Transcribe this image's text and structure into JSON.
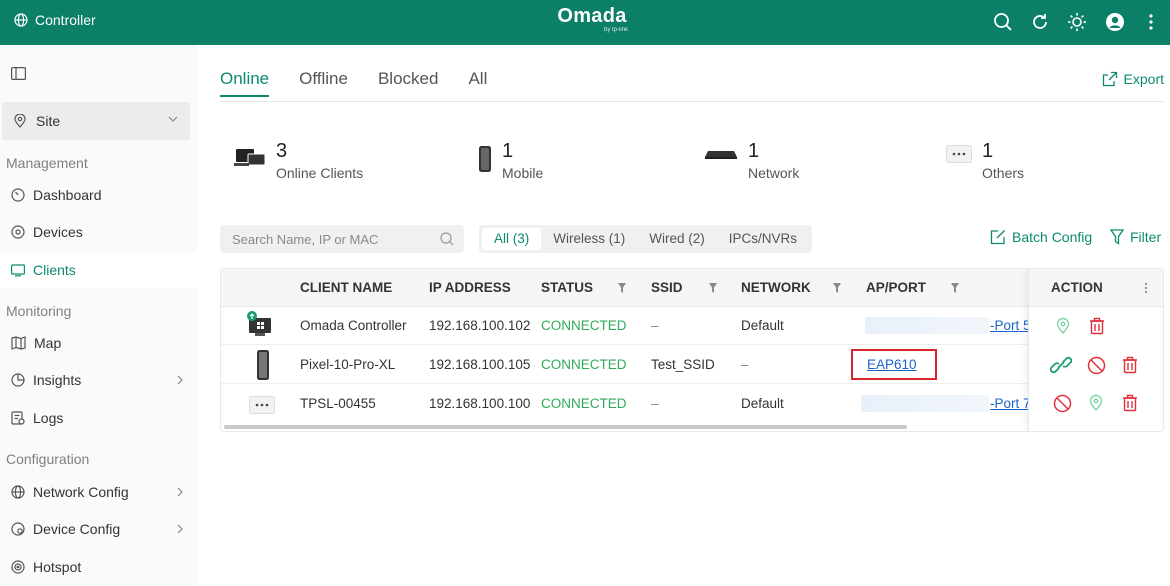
{
  "topbar": {
    "brand": "Controller",
    "logo": "Omada",
    "logo_sub": "by tp-link"
  },
  "sidebar": {
    "site_label": "Site",
    "groups": [
      "Management",
      "Monitoring",
      "Configuration"
    ],
    "items": [
      {
        "label": "Dashboard"
      },
      {
        "label": "Devices"
      },
      {
        "label": "Clients"
      },
      {
        "label": "Map"
      },
      {
        "label": "Insights"
      },
      {
        "label": "Logs"
      },
      {
        "label": "Network Config"
      },
      {
        "label": "Device Config"
      },
      {
        "label": "Hotspot"
      }
    ]
  },
  "tabs": [
    "Online",
    "Offline",
    "Blocked",
    "All"
  ],
  "export_label": "Export",
  "summary": [
    {
      "count": "3",
      "label": "Online Clients"
    },
    {
      "count": "1",
      "label": "Mobile"
    },
    {
      "count": "1",
      "label": "Network"
    },
    {
      "count": "1",
      "label": "Others"
    }
  ],
  "search": {
    "placeholder": "Search Name, IP or MAC"
  },
  "filters": [
    "All (3)",
    "Wireless (1)",
    "Wired (2)",
    "IPCs/NVRs"
  ],
  "batch_config_label": "Batch Config",
  "filter_label": "Filter",
  "table": {
    "headers": [
      "CLIENT NAME",
      "IP ADDRESS",
      "STATUS",
      "SSID",
      "NETWORK",
      "AP/PORT",
      "ACTION"
    ],
    "rows": [
      {
        "name": "Omada Controller",
        "ip": "192.168.100.102",
        "status": "CONNECTED",
        "ssid": "–",
        "network": "Default",
        "ap": "-Port 5"
      },
      {
        "name": "Pixel-10-Pro-XL",
        "ip": "192.168.100.105",
        "status": "CONNECTED",
        "ssid": "Test_SSID",
        "network": "–",
        "ap": "EAP610"
      },
      {
        "name": "TPSL-00455",
        "ip": "192.168.100.100",
        "status": "CONNECTED",
        "ssid": "–",
        "network": "Default",
        "ap": "-Port 7"
      }
    ]
  },
  "colors": {
    "brand": "#0c7f68",
    "accent": "#0c8a70",
    "connected": "#2eaa5b",
    "danger": "#e0303a",
    "link": "#1a63c8"
  }
}
